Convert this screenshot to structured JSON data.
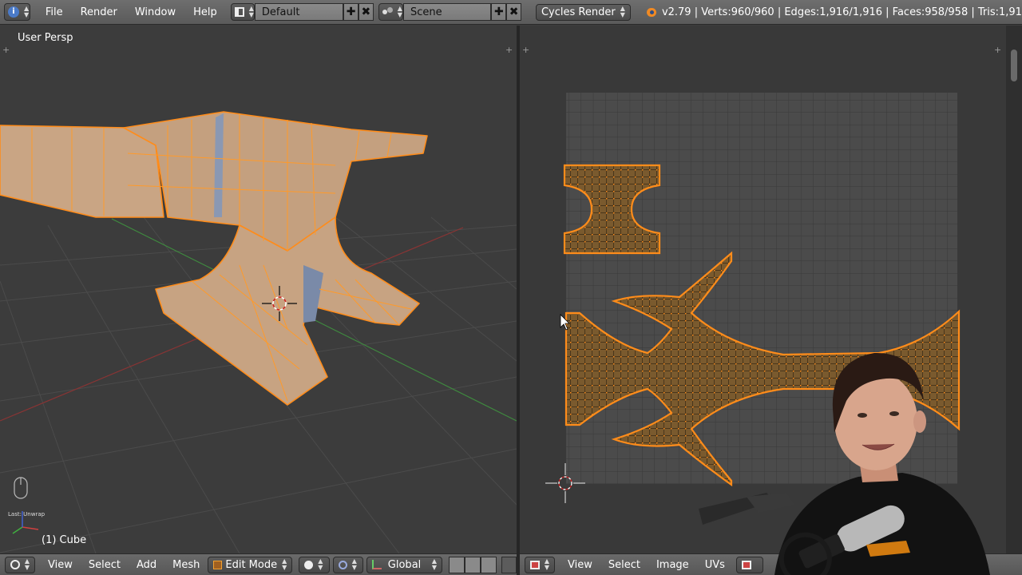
{
  "menu": {
    "file": "File",
    "render": "Render",
    "window": "Window",
    "help": "Help"
  },
  "layout": {
    "value": "Default"
  },
  "scene": {
    "value": "Scene"
  },
  "engine": {
    "value": "Cycles Render"
  },
  "stats": "v2.79 | Verts:960/960 | Edges:1,916/1,916 | Faces:958/958 | Tris:1,91",
  "viewport3d": {
    "label": "User Persp",
    "object_label": "(1) Cube",
    "last_op": "Last: Unwrap",
    "header": {
      "view": "View",
      "select": "Select",
      "add": "Add",
      "mesh": "Mesh",
      "mode": "Edit Mode",
      "orientation": "Global"
    }
  },
  "uv_editor": {
    "header": {
      "view": "View",
      "select": "Select",
      "image": "Image",
      "uvs": "UVs"
    }
  },
  "colors": {
    "selection": "#ff8c1a",
    "mesh_fill": "#c8a07a",
    "uv_fill": "#7a5a2e",
    "grid_bg": "#4a4a4a",
    "axis_x": "#b03030",
    "axis_y": "#3a9a3a"
  },
  "icons": [
    "info-icon",
    "screen-layout-icon",
    "scene-icon",
    "blender-logo-icon",
    "mouse-icon",
    "cursor-icon",
    "axes-gizmo-icon"
  ]
}
